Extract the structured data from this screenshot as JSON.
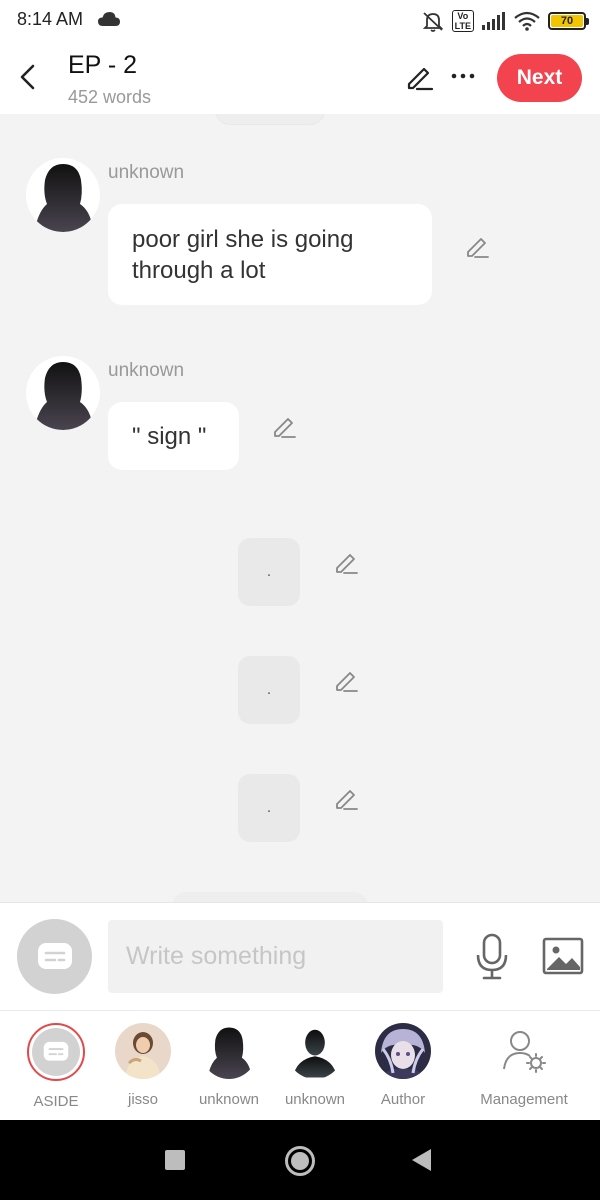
{
  "status_bar": {
    "time": "8:14 AM",
    "battery_level": "70",
    "icons": [
      "cloud-icon",
      "alarm-off-icon",
      "volte-icon",
      "signal-icon",
      "wifi-icon",
      "battery-icon"
    ],
    "volte_top": "Vo",
    "volte_bottom": "LTE"
  },
  "header": {
    "title": "EP - 2",
    "word_count": "452 words",
    "next_label": "Next"
  },
  "messages": [
    {
      "sender": "unknown",
      "text_line1": "poor girl she is going",
      "text_line2": "through a lot"
    },
    {
      "sender": "unknown",
      "text": "\" sign \""
    }
  ],
  "narration": [
    {
      "text": "."
    },
    {
      "text": "."
    },
    {
      "text": "."
    }
  ],
  "composer": {
    "placeholder": "Write something"
  },
  "characters": [
    {
      "label": "ASIDE"
    },
    {
      "label": "jisso"
    },
    {
      "label": "unknown"
    },
    {
      "label": "unknown"
    },
    {
      "label": "Author"
    },
    {
      "label": "Management"
    }
  ],
  "colors": {
    "accent": "#f2434e",
    "background": "#f3f3f3",
    "aside_ring": "#e24a4a"
  }
}
